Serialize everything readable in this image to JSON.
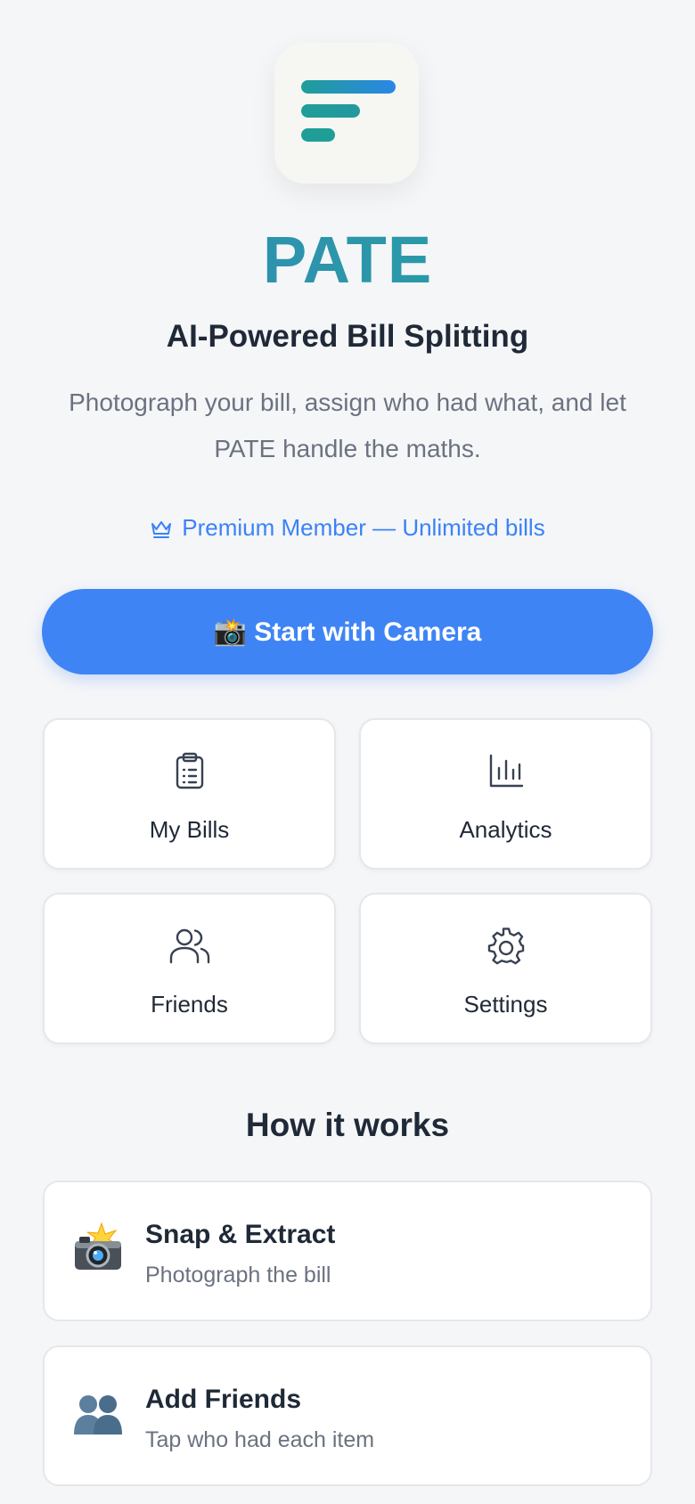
{
  "brand": {
    "name": "PATE",
    "tagline": "AI-Powered Bill Splitting",
    "description": "Photograph your bill, assign who had what, and let PATE handle the maths.",
    "colors": {
      "primary": "#3f84f5",
      "teal": "#1f9e98",
      "text": "#1f2937",
      "muted": "#6b7280"
    }
  },
  "membership": {
    "icon": "crown-icon",
    "text": "Premium Member — Unlimited bills"
  },
  "cta": {
    "icon": "camera-flash-emoji",
    "label": "📸 Start with Camera"
  },
  "tiles": [
    {
      "icon": "clipboard-icon",
      "label": "My Bills"
    },
    {
      "icon": "bar-chart-icon",
      "label": "Analytics"
    },
    {
      "icon": "users-icon",
      "label": "Friends"
    },
    {
      "icon": "gear-icon",
      "label": "Settings"
    }
  ],
  "how_it_works": {
    "title": "How it works",
    "steps": [
      {
        "icon": "camera-flash-emoji",
        "title": "Snap & Extract",
        "subtitle": "Photograph the bill"
      },
      {
        "icon": "people-emoji",
        "title": "Add Friends",
        "subtitle": "Tap who had each item"
      }
    ]
  }
}
